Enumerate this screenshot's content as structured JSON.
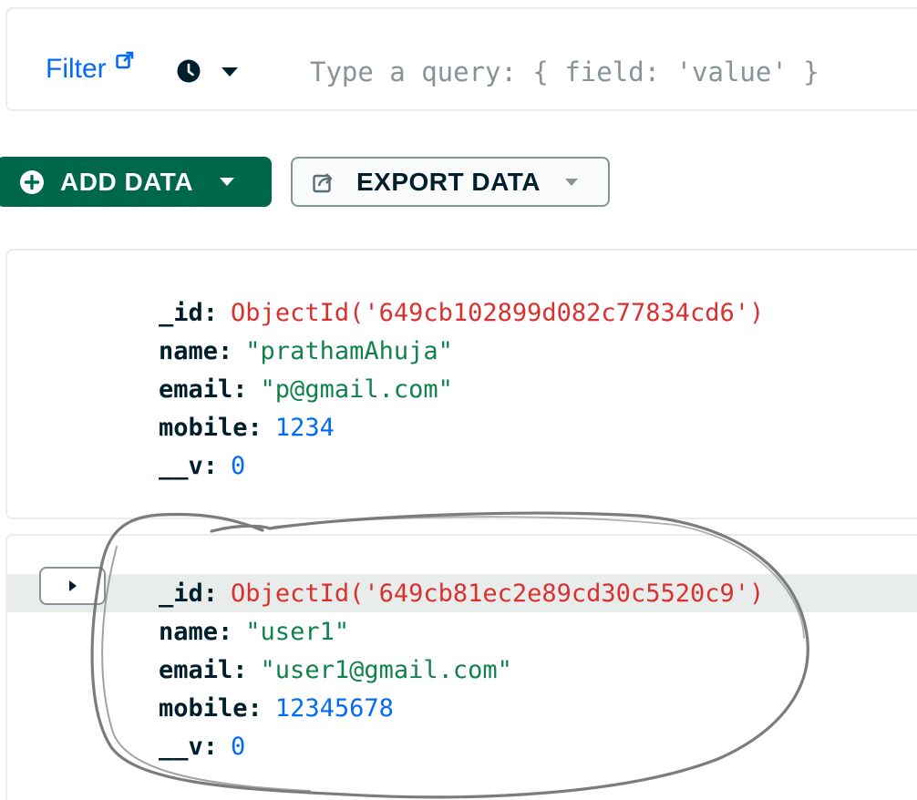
{
  "filter_bar": {
    "filter_label": "Filter",
    "query_placeholder": "Type a query: { field: 'value' }",
    "query_value": ""
  },
  "toolbar": {
    "add_data_label": "ADD DATA",
    "export_data_label": "EXPORT DATA"
  },
  "documents": [
    {
      "fields": [
        {
          "key": "_id",
          "value": "ObjectId('649cb102899d082c77834cd6')",
          "type": "objectid"
        },
        {
          "key": "name",
          "value": "\"prathamAhuja\"",
          "type": "string"
        },
        {
          "key": "email",
          "value": "\"p@gmail.com\"",
          "type": "string"
        },
        {
          "key": "mobile",
          "value": "1234",
          "type": "number"
        },
        {
          "key": "__v",
          "value": "0",
          "type": "number"
        }
      ]
    },
    {
      "fields": [
        {
          "key": "_id",
          "value": "ObjectId('649cb81ec2e89cd30c5520c9')",
          "type": "objectid"
        },
        {
          "key": "name",
          "value": "\"user1\"",
          "type": "string"
        },
        {
          "key": "email",
          "value": "\"user1@gmail.com\"",
          "type": "string"
        },
        {
          "key": "mobile",
          "value": "12345678",
          "type": "number"
        },
        {
          "key": "__v",
          "value": "0",
          "type": "number"
        }
      ]
    }
  ],
  "colors": {
    "brand_green": "#00684a",
    "link_blue": "#016bf8",
    "objectid_red": "#db3030",
    "string_green": "#12824d",
    "number_blue": "#016bf8",
    "annotation_gray": "#6e6e6e"
  },
  "icons": {
    "external_link": "external-link-icon",
    "history": "clock-icon",
    "add": "plus-circle-icon",
    "export": "export-icon",
    "expand": "caret-right-icon"
  }
}
